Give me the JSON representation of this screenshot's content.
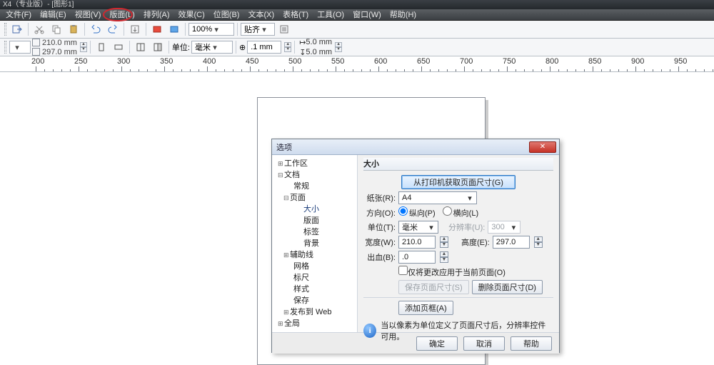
{
  "app_title": "X4（专业版）- [图形1]",
  "menus": [
    "文件(F)",
    "编辑(E)",
    "视图(V)",
    "版面(L)",
    "排列(A)",
    "效果(C)",
    "位图(B)",
    "文本(X)",
    "表格(T)",
    "工具(O)",
    "窗口(W)",
    "帮助(H)"
  ],
  "toolbar": {
    "zoom": "100%",
    "snap_label": "贴齐",
    "page_width": "210.0 mm",
    "page_height": "297.0 mm",
    "units_label": "单位:",
    "units_value": "毫米",
    "nudge_step": ".1 mm",
    "dup_x": "5.0 mm",
    "dup_y": "5.0 mm"
  },
  "ruler_labels": [
    "200",
    "250",
    "300",
    "350",
    "400",
    "450",
    "500",
    "550",
    "600",
    "650",
    "700",
    "750",
    "800",
    "850",
    "900",
    "950"
  ],
  "dialog": {
    "title": "选项",
    "tree": {
      "workspace": "工作区",
      "document": "文档",
      "general": "常规",
      "page": "页面",
      "size": "大小",
      "layout": "版面",
      "label": "标签",
      "background": "背景",
      "guidelines": "辅助线",
      "grid": "网格",
      "rulers": "标尺",
      "styles": "样式",
      "save": "保存",
      "publish_web": "发布到 Web",
      "global": "全局"
    },
    "panel": {
      "title": "大小",
      "from_printer_btn": "从打印机获取页面尺寸(G)",
      "paper_label": "纸张(R):",
      "paper_value": "A4",
      "orient_label": "方向(O):",
      "portrait": "纵向(P)",
      "landscape": "横向(L)",
      "units_label": "单位(T):",
      "units_value": "毫米",
      "res_label": "分辨率(U):",
      "res_value": "300",
      "width_label": "宽度(W):",
      "width_value": "210.0",
      "height_label": "高度(E):",
      "height_value": "297.0",
      "bleed_label": "出血(B):",
      "bleed_value": ".0",
      "apply_current": "仅将更改应用于当前页面(O)",
      "save_size_btn": "保存页面尺寸(S)",
      "delete_size_btn": "删除页面尺寸(D)",
      "add_frame_btn": "添加页框(A)",
      "info_text": "当以像素为单位定义了页面尺寸后，分辨率控件可用。"
    },
    "ok": "确定",
    "cancel": "取消",
    "help": "帮助"
  }
}
